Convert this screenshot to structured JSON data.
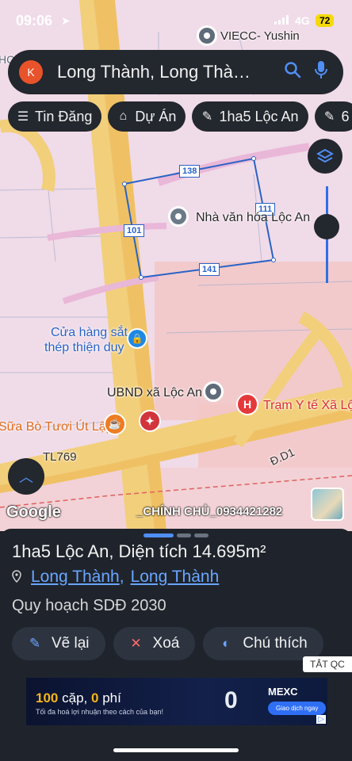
{
  "status_bar": {
    "time": "09:06",
    "network": "4G",
    "battery": "72"
  },
  "search": {
    "avatar_letter": "K",
    "query": "Long Thành, Long Thà…"
  },
  "chips": [
    {
      "icon": "list-icon",
      "label": "Tin Đăng"
    },
    {
      "icon": "building-icon",
      "label": "Dự Án"
    },
    {
      "icon": "ruler-icon",
      "label": "1ha5 Lộc An"
    },
    {
      "icon": "ruler-icon",
      "label": "6"
    }
  ],
  "map": {
    "poi_labels": {
      "viecc": "VIECC- Yushin",
      "nha_van_hoa": "Nhà văn hóa Lộc An",
      "cua_hang_line1": "Cửa hàng sắt",
      "cua_hang_line2": "thép thiện duy",
      "ubnd": "UBND xã Lộc An",
      "tram_y_te": "Trạm Y tế Xã Lộc",
      "sua_bo": "Sữa Bò Tươi Út Lập",
      "road_tl769": "TL769",
      "road_dd1": "Đ.D1",
      "edge_hc": "HC"
    },
    "dimensions": {
      "top": "138",
      "left": "101",
      "right": "111",
      "bottom": "141"
    },
    "google": "Google",
    "watermark": "_CHÍNH CHỦ_0934421282"
  },
  "sheet": {
    "title": "1ha5 Lộc An, Diện tích 14.695m²",
    "location_1": "Long Thành",
    "location_sep": ",",
    "location_2": "Long Thành",
    "plan": "Quy hoạch SDĐ 2030",
    "actions": [
      {
        "icon": "ruler-icon",
        "label": "Vẽ lại"
      },
      {
        "icon": "close-icon",
        "label": "Xoá"
      },
      {
        "icon": "contrast-icon",
        "label": "Chú thích"
      }
    ],
    "hide_ads": "TẮT QC"
  },
  "ad": {
    "headline_num": "100",
    "headline_word": "cặp,",
    "headline_zero": "0",
    "headline_fee": "phí",
    "subtitle": "Tối đa hoá lợi nhuận theo cách của bạn!",
    "brand": "MEXC",
    "big_zero": "0",
    "cta": "Giao dịch ngay"
  },
  "colors": {
    "map_bg": "#f0dbe8",
    "road": "#f2cf7a",
    "parcel_outline": "#2a63c6",
    "panel_bg": "#1f242c",
    "accent": "#4f8ff5"
  }
}
